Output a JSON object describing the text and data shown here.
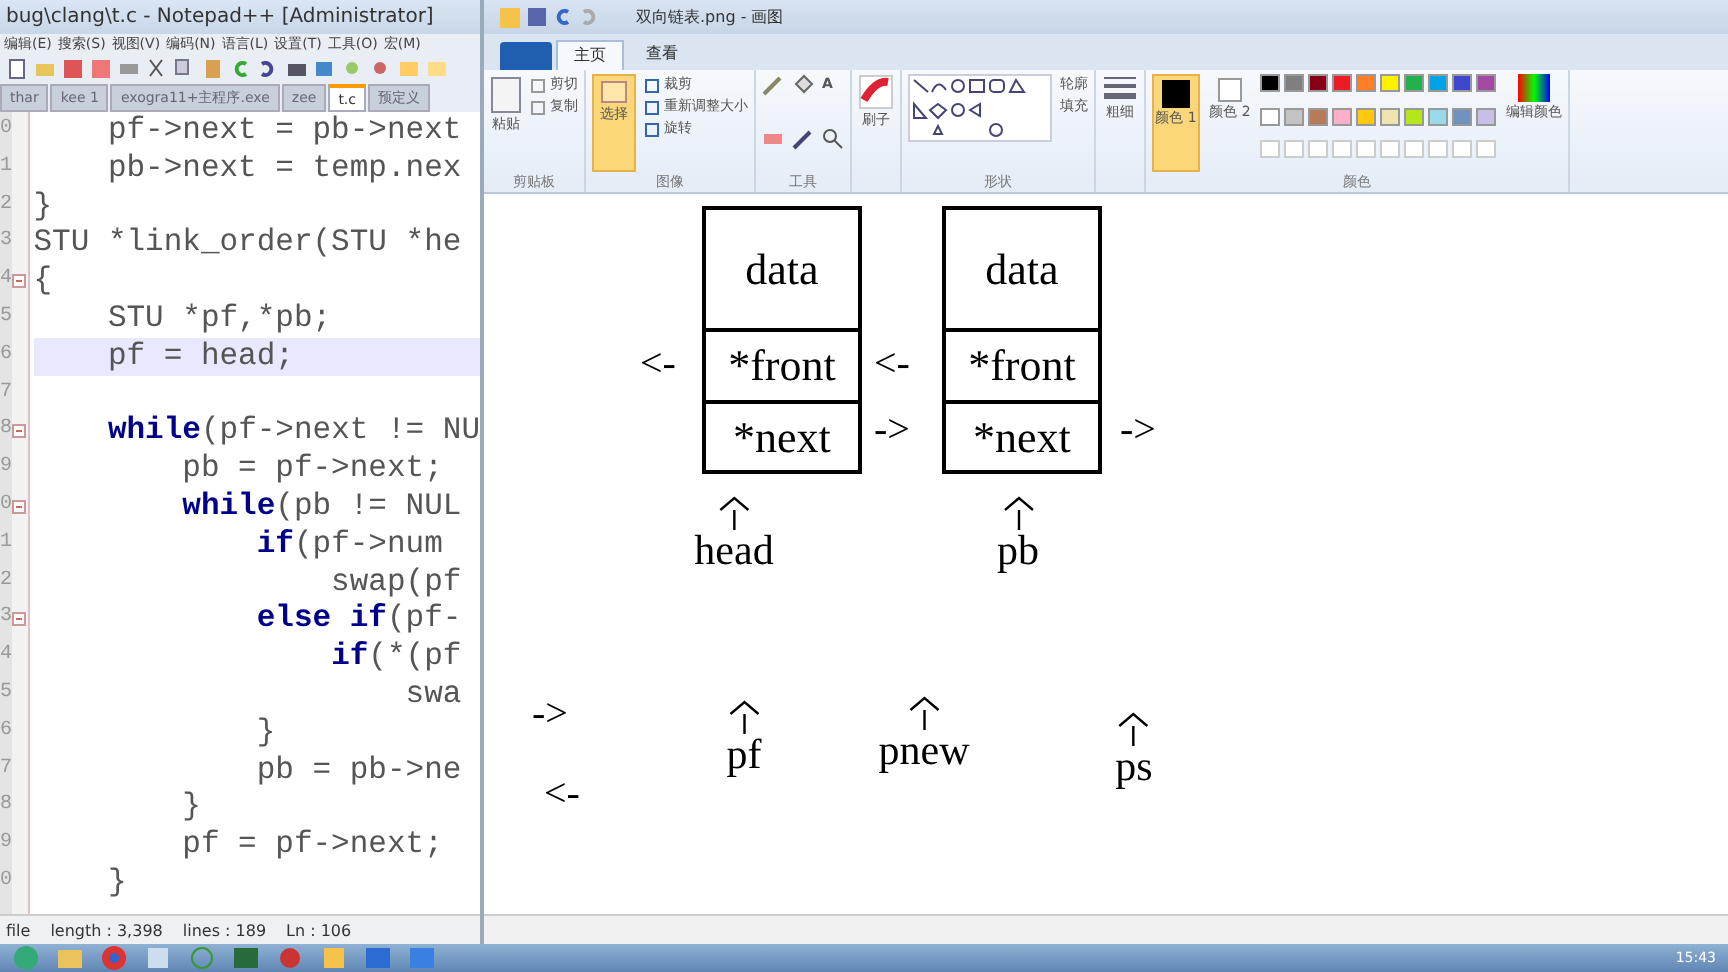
{
  "notepad": {
    "title": "bug\\clang\\t.c - Notepad++ [Administrator]",
    "menu": [
      "编辑(E)",
      "搜索(S)",
      "视图(V)",
      "编码(N)",
      "语言(L)",
      "设置(T)",
      "工具(O)",
      "宏(M)"
    ],
    "tabs": [
      {
        "label": "thar",
        "selected": false
      },
      {
        "label": "kee 1",
        "selected": false
      },
      {
        "label": "exogra11+主程序.exe",
        "selected": false
      },
      {
        "label": "zee",
        "selected": false
      },
      {
        "label": "t.c",
        "selected": true
      },
      {
        "label": "预定义",
        "selected": false
      }
    ],
    "code": [
      {
        "num": "0",
        "text": "    pf->next = pb->next",
        "current": false,
        "fold": false
      },
      {
        "num": "1",
        "text": "    pb->next = temp.nex",
        "current": false,
        "fold": false
      },
      {
        "num": "2",
        "text": "}",
        "current": false,
        "fold": false
      },
      {
        "num": "3",
        "text": "STU *link_order(STU *he",
        "current": false,
        "fold": false
      },
      {
        "num": "4",
        "text": "{",
        "current": false,
        "fold": true
      },
      {
        "num": "5",
        "text": "    STU *pf,*pb;",
        "current": false,
        "fold": false
      },
      {
        "num": "6",
        "text": "    pf = head;",
        "current": true,
        "fold": false
      },
      {
        "num": "7",
        "current": false,
        "fold": false
      },
      {
        "num": "8",
        "text": "    **while**(pf->next != NU",
        "current": false,
        "fold": true
      },
      {
        "num": "9",
        "text": "        pb = pf->next;",
        "current": false,
        "fold": false
      },
      {
        "num": "0",
        "text": "        **while**(pb != NUL",
        "current": false,
        "fold": true
      },
      {
        "num": "1",
        "text": "            **if**(pf->num",
        "current": false,
        "fold": false
      },
      {
        "num": "2",
        "text": "                swap(pf",
        "current": false,
        "fold": false
      },
      {
        "num": "3",
        "text": "            **else if**(pf-",
        "current": false,
        "fold": true
      },
      {
        "num": "4",
        "text": "                **if**(*(pf",
        "current": false,
        "fold": false
      },
      {
        "num": "5",
        "text": "                    swa",
        "current": false,
        "fold": false
      },
      {
        "num": "6",
        "text": "            }",
        "current": false,
        "fold": false
      },
      {
        "num": "7",
        "text": "            pb = pb->ne",
        "current": false,
        "fold": false
      },
      {
        "num": "8",
        "text": "        }",
        "current": false,
        "fold": false
      },
      {
        "num": "9",
        "text": "        pf = pf->next;",
        "current": false,
        "fold": false
      },
      {
        "num": "0",
        "text": "    }",
        "current": false,
        "fold": false
      }
    ],
    "status_bar": [
      "file",
      "length : 3,398",
      "lines : 189",
      "Ln : 106"
    ]
  },
  "paint": {
    "title": "双向链表.png - 画图",
    "tabs": [
      {
        "label": "主页",
        "selected": true
      },
      {
        "label": "查看",
        "selected": false
      }
    ],
    "clipboard": {
      "paste": "粘贴",
      "cut": "剪切",
      "copy": "复制",
      "label": "剪贴板"
    },
    "image": {
      "select": "选择",
      "crop": "裁剪",
      "resize": "重新调整大小",
      "rotate": "旋转",
      "label": "图像"
    },
    "tools": {
      "text_tool": "A",
      "label": "工具"
    },
    "brushes": "刷子",
    "shapes": {
      "outline": "轮廓",
      "fill": "填充",
      "label": "形状"
    },
    "size": "粗细",
    "color1": "颜色 1",
    "color2": "颜色 2",
    "colors_label": "颜色",
    "edit_colors": "编辑颜色",
    "palette": [
      {
        "color": "#000000"
      },
      {
        "color": "#7f7f7f"
      },
      {
        "color": "#880015"
      },
      {
        "color": "#ed1c24"
      },
      {
        "color": "#ff7f27"
      },
      {
        "color": "#fff200"
      },
      {
        "color": "#22b14c"
      },
      {
        "color": "#00a2e8"
      },
      {
        "color": "#3f48cc"
      },
      {
        "color": "#a349a4"
      },
      {
        "color": "#ffffff"
      },
      {
        "color": "#c3c3c3"
      },
      {
        "color": "#b97a57"
      },
      {
        "color": "#ffaec9"
      },
      {
        "color": "#ffc90e"
      },
      {
        "color": "#efe4b0"
      },
      {
        "color": "#b5e61d"
      },
      {
        "color": "#99d9ea"
      },
      {
        "color": "#7092be"
      },
      {
        "color": "#c8bfe7"
      }
    ],
    "canvas": {
      "nodes": [
        {
          "fields": [
            "data",
            "*front",
            "*next"
          ]
        },
        {
          "fields": [
            "data",
            "*front",
            "*next"
          ]
        }
      ],
      "arrows": [
        "<-",
        "<-",
        "->",
        "->",
        "->",
        "<-"
      ],
      "pointers": [
        "head",
        "pb",
        "pf",
        "pnew",
        "ps"
      ]
    }
  },
  "taskbar": {
    "time": "15:43"
  }
}
